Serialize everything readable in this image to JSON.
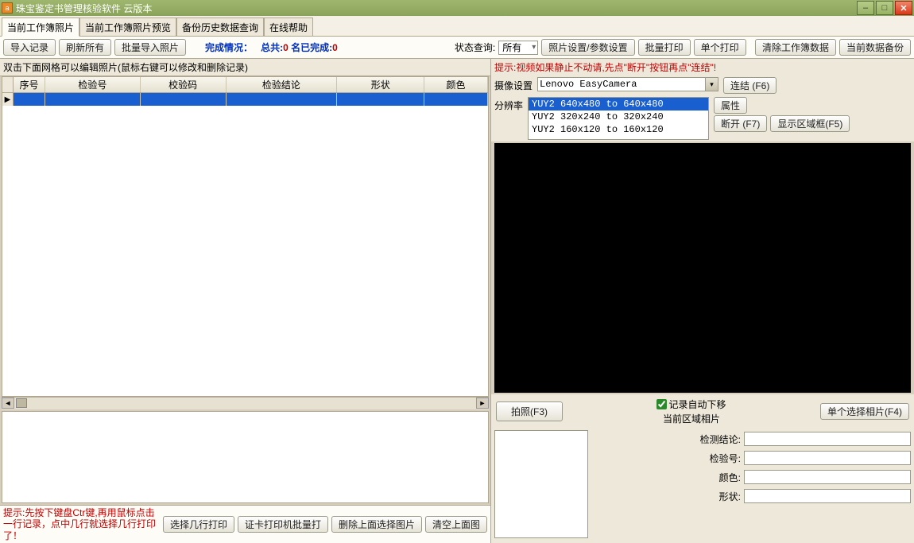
{
  "window": {
    "title": "珠宝鉴定书管理核验软件 云版本",
    "icon_char": "a"
  },
  "tabs": [
    "当前工作簿照片",
    "当前工作簿照片预览",
    "备份历史数据查询",
    "在线帮助"
  ],
  "toolbar": {
    "import": "导入记录",
    "refresh": "刷新所有",
    "batch_import": "批量导入照片",
    "status_pre": "完成情况：",
    "status_total_label": "总共:",
    "status_total": "0",
    "status_done_label": "名已完成:",
    "status_done": "0",
    "query_label": "状态查询:",
    "query_value": "所有",
    "photo_set": "照片设置/参数设置",
    "batch_print": "批量打印",
    "single_print": "单个打印",
    "clear_data": "清除工作簿数据",
    "backup": "当前数据备份"
  },
  "grid": {
    "hint": "双击下面网格可以编辑照片(鼠标右键可以修改和删除记录)",
    "cols": [
      "序号",
      "检验号",
      "校验码",
      "检验结论",
      "形状",
      "颜色"
    ]
  },
  "bottom": {
    "hint": "提示:先按下键盘Ctr键,再用鼠标点击一行记录，点中几行就选择几行打印了！",
    "sel_print": "选择几行打印",
    "card_print": "证卡打印机批量打",
    "del_sel": "删除上面选择图片",
    "clear_up": "清空上面图"
  },
  "right": {
    "hint": "提示:视频如果静止不动请,先点\"断开\"按钮再点\"连结\"!",
    "cam_label": "摄像设置",
    "cam_value": "Lenovo EasyCamera",
    "res_label": "分辨率",
    "res_opts": [
      "YUY2 640x480 to 640x480",
      "YUY2 320x240 to 320x240",
      "YUY2 160x120 to 160x120"
    ],
    "connect": "连结 (F6)",
    "prop": "属性",
    "disconnect": "断开 (F7)",
    "showbox": "显示区域框(F5)",
    "capture": "拍照(F3)",
    "auto_down": "记录自动下移",
    "cur_area": "当前区域相片",
    "single_sel": "单个选择相片(F4)",
    "f_result": "检测结论:",
    "f_num": "检验号:",
    "f_color": "颜色:",
    "f_shape": "形状:"
  }
}
